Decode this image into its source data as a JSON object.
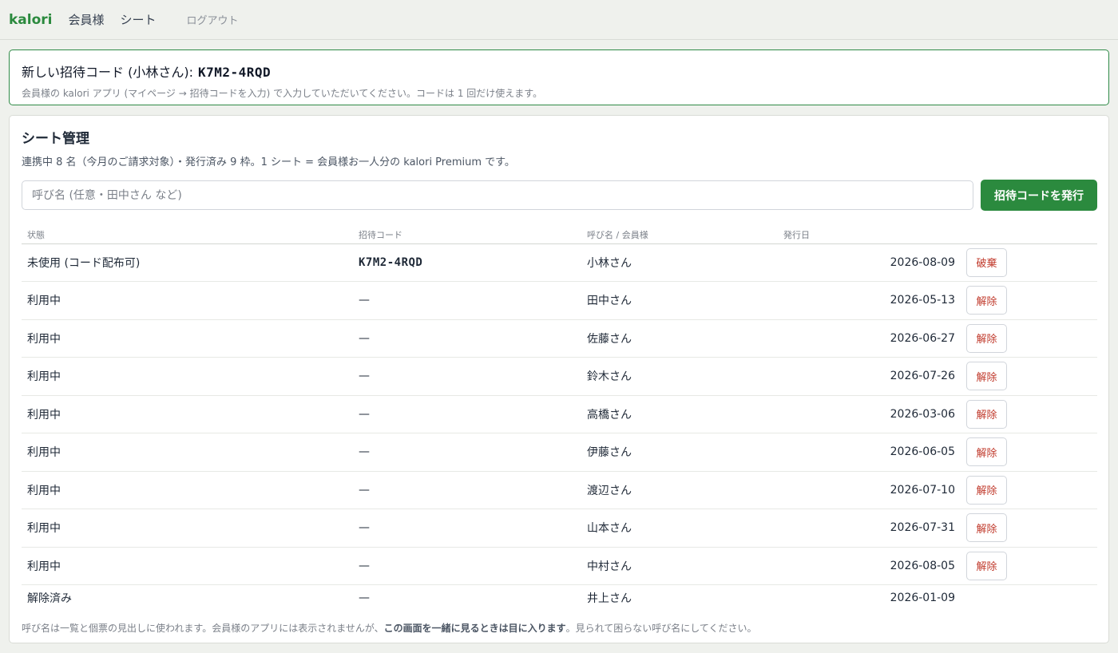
{
  "nav": {
    "brand": "kalori",
    "links": [
      "会員様",
      "シート"
    ],
    "logout": "ログアウト"
  },
  "banner": {
    "title": "新しい招待コード (小林さん):",
    "code": "K7M2-4RQD",
    "note": "会員様の kalori アプリ (マイページ → 招待コードを入力) で入力していただいてください。コードは 1 回だけ使えます。"
  },
  "seats": {
    "title": "シート管理",
    "summary": "連携中 8 名（今月のご請求対象）・発行済み 9 枠。1 シート = 会員様お一人分の kalori Premium です。",
    "input_placeholder": "呼び名 (任意・田中さん など)",
    "issue_button": "招待コードを発行",
    "columns": [
      "状態",
      "招待コード",
      "呼び名 / 会員様",
      "発行日"
    ],
    "rows": [
      {
        "status": "未使用 (コード配布可)",
        "code": "K7M2-4RQD",
        "name": "小林さん",
        "date": "2026-08-09",
        "action": "破棄"
      },
      {
        "status": "利用中",
        "code": "—",
        "name": "田中さん",
        "date": "2026-05-13",
        "action": "解除"
      },
      {
        "status": "利用中",
        "code": "—",
        "name": "佐藤さん",
        "date": "2026-06-27",
        "action": "解除"
      },
      {
        "status": "利用中",
        "code": "—",
        "name": "鈴木さん",
        "date": "2026-07-26",
        "action": "解除"
      },
      {
        "status": "利用中",
        "code": "—",
        "name": "高橋さん",
        "date": "2026-03-06",
        "action": "解除"
      },
      {
        "status": "利用中",
        "code": "—",
        "name": "伊藤さん",
        "date": "2026-06-05",
        "action": "解除"
      },
      {
        "status": "利用中",
        "code": "—",
        "name": "渡辺さん",
        "date": "2026-07-10",
        "action": "解除"
      },
      {
        "status": "利用中",
        "code": "—",
        "name": "山本さん",
        "date": "2026-07-31",
        "action": "解除"
      },
      {
        "status": "利用中",
        "code": "—",
        "name": "中村さん",
        "date": "2026-08-05",
        "action": "解除"
      },
      {
        "status": "解除済み",
        "code": "—",
        "name": "井上さん",
        "date": "2026-01-09",
        "action": ""
      }
    ],
    "footnote_before": "呼び名は一覧と個票の見出しに使われます。会員様のアプリには表示されませんが、",
    "footnote_bold": "この画面を一緒に見るときは目に入ります",
    "footnote_after": "。見られて困らない呼び名にしてください。"
  },
  "colors": {
    "accent": "#2b8a3e",
    "danger": "#c0392b",
    "background": "#eff1ed"
  }
}
